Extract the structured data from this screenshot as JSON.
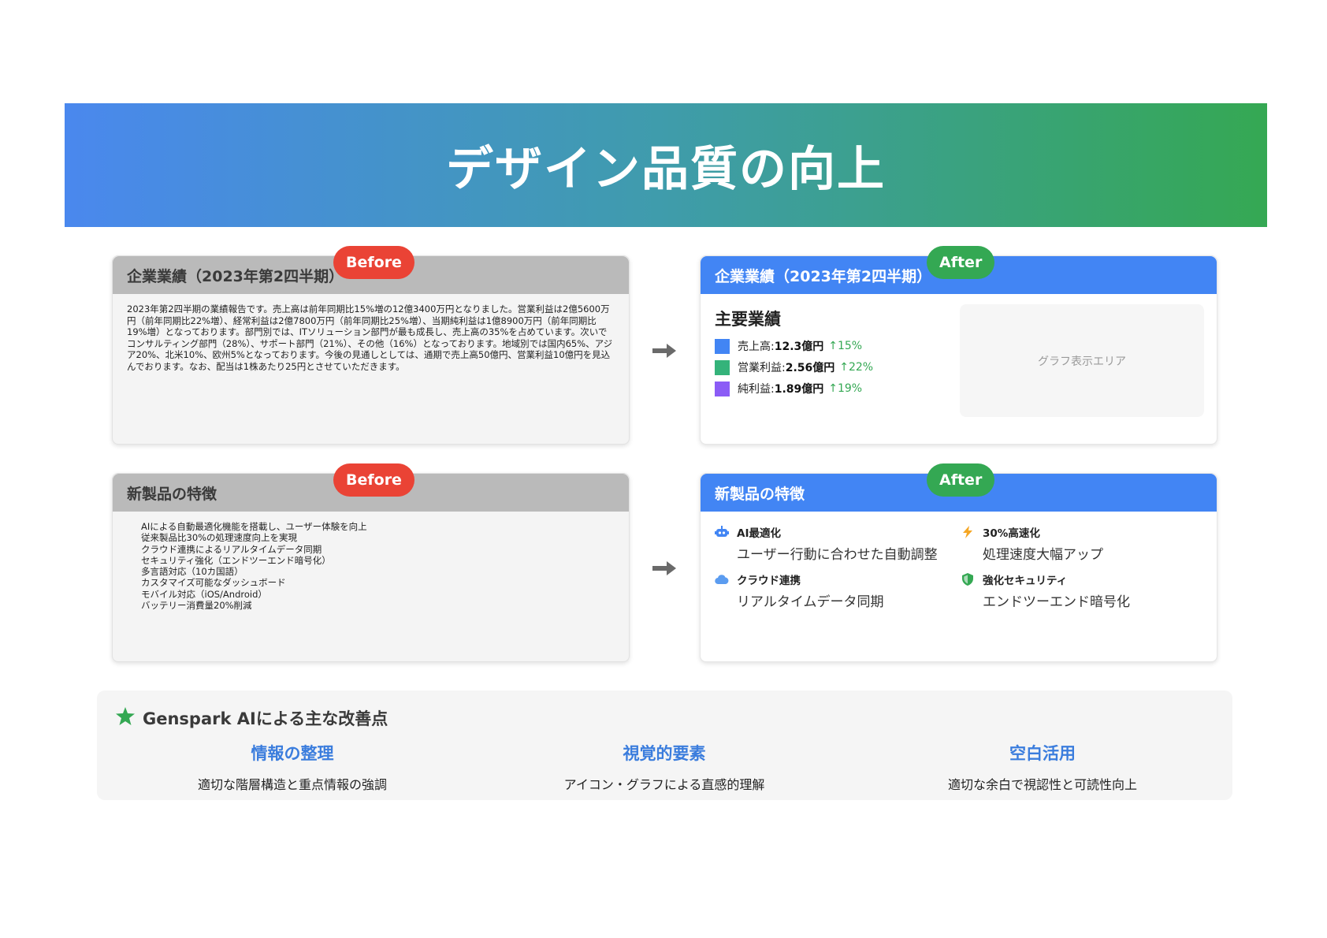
{
  "banner": {
    "title": "デザイン品質の向上"
  },
  "comparisons": [
    {
      "before": {
        "badge": "Before",
        "title": "企業業績（2023年第2四半期）",
        "text": "2023年第2四半期の業績報告です。売上高は前年同期比15%増の12億3400万円となりました。営業利益は2億5600万円（前年同期比22%増）、経常利益は2億7800万円（前年同期比25%増）、当期純利益は1億8900万円（前年同期比19%増）となっております。部門別では、ITソリューション部門が最も成長し、売上高の35%を占めています。次いでコンサルティング部門（28%）、サポート部門（21%）、その他（16%）となっております。地域別では国内65%、アジア20%、北米10%、欧州5%となっております。今後の見通しとしては、通期で売上高50億円、営業利益10億円を見込んでおります。なお、配当は1株あたり25円とさせていただきます。"
      },
      "after": {
        "badge": "After",
        "title": "企業業績（2023年第2四半期）",
        "metrics_title": "主要業績",
        "metrics": [
          {
            "label": "売上高: ",
            "value": "12.3億円",
            "change": "↑15%",
            "color": "#4285f4"
          },
          {
            "label": "営業利益: ",
            "value": "2.56億円",
            "change": "↑22%",
            "color": "#34b37a"
          },
          {
            "label": "純利益: ",
            "value": "1.89億円",
            "change": "↑19%",
            "color": "#8b5cf6"
          }
        ],
        "graph_placeholder": "グラフ表示エリア"
      }
    },
    {
      "before": {
        "badge": "Before",
        "title": "新製品の特徴",
        "items": [
          "AIによる自動最適化機能を搭載し、ユーザー体験を向上",
          "従来製品比30%の処理速度向上を実現",
          "クラウド連携によるリアルタイムデータ同期",
          "セキュリティ強化（エンドツーエンド暗号化）",
          "多言語対応（10カ国語）",
          "カスタマイズ可能なダッシュボード",
          "モバイル対応（iOS/Android）",
          "バッテリー消費量20%削減"
        ]
      },
      "after": {
        "badge": "After",
        "title": "新製品の特徴",
        "features": [
          {
            "icon": "robot-icon",
            "icon_color": "#4285f4",
            "title": "AI最適化",
            "desc": "ユーザー行動に合わせた自動調整"
          },
          {
            "icon": "bolt-icon",
            "icon_color": "#f5a623",
            "title": "30%高速化",
            "desc": "処理速度大幅アップ"
          },
          {
            "icon": "cloud-icon",
            "icon_color": "#5b9cf0",
            "title": "クラウド連携",
            "desc": "リアルタイムデータ同期"
          },
          {
            "icon": "shield-icon",
            "icon_color": "#34a853",
            "title": "強化セキュリティ",
            "desc": "エンドツーエンド暗号化"
          }
        ]
      }
    }
  ],
  "summary": {
    "title": "Genspark AIによる主な改善点",
    "points": [
      {
        "title": "情報の整理",
        "desc": "適切な階層構造と重点情報の強調"
      },
      {
        "title": "視覚的要素",
        "desc": "アイコン・グラフによる直感的理解"
      },
      {
        "title": "空白活用",
        "desc": "適切な余白で視認性と可読性向上"
      }
    ]
  },
  "colors": {
    "before_header": "#bababa",
    "after_header": "#4285f4",
    "badge_before": "#ea4335",
    "badge_after": "#34a853",
    "accent_text": "#3b7ddd"
  }
}
